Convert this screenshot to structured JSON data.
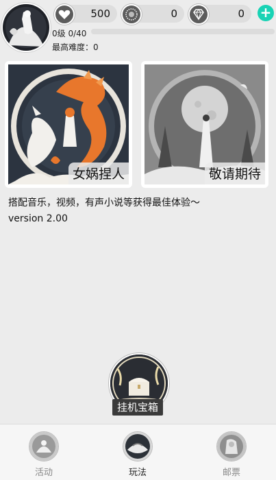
{
  "header": {
    "hearts": "500",
    "coins": "0",
    "diamonds": "0",
    "add_label": "+",
    "level_text": "0级 0/40",
    "level_progress": 0,
    "difficulty_text": "最高难度：0"
  },
  "cards": [
    {
      "label": "女娲捏人"
    },
    {
      "label": "敬请期待"
    }
  ],
  "description": "搭配音乐，视频，有声小说等获得最佳体验～",
  "version": "version 2.00",
  "chest": {
    "label": "挂机宝箱"
  },
  "nav": {
    "items": [
      {
        "label": "活动"
      },
      {
        "label": "玩法"
      },
      {
        "label": "邮票"
      }
    ],
    "active_index": 1
  },
  "colors": {
    "accent": "#19d3b5",
    "background": "#ececec"
  }
}
